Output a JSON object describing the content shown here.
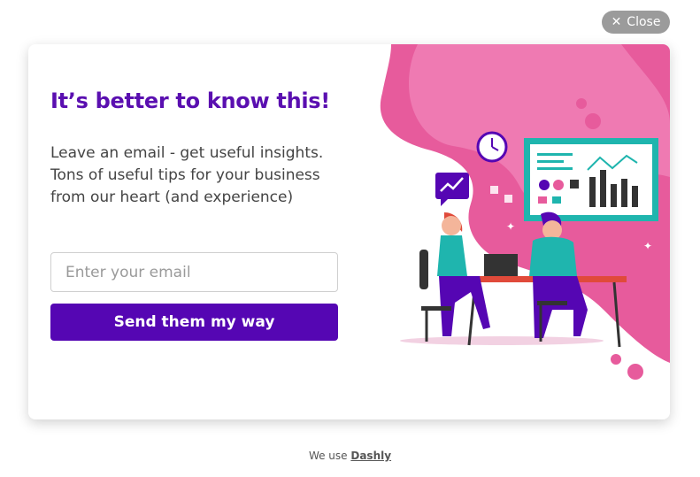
{
  "close_button": {
    "label": "Close",
    "icon": "close-icon"
  },
  "popup": {
    "title": "It’s better to know this!",
    "description_lines": [
      "Leave an email - get useful insights.",
      "Tons of useful tips for your business",
      "from our heart (and experience)"
    ],
    "email_input": {
      "placeholder": "Enter your email",
      "value": ""
    },
    "submit_label": "Send them my way"
  },
  "footer": {
    "text": "We use",
    "link": "Dashly"
  },
  "colors": {
    "accent": "#5506b3",
    "title": "#5a0fb0",
    "pink": "#e75b9c",
    "teal": "#1fb5ae"
  }
}
